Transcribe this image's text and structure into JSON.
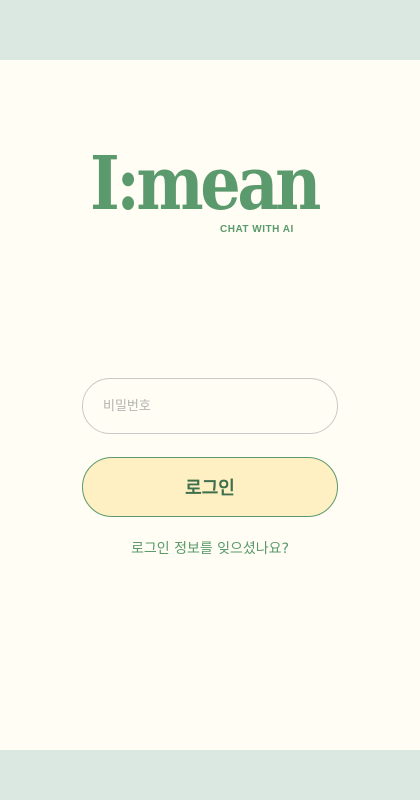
{
  "logo": {
    "wordmark": "I:mean",
    "tagline": "CHAT WITH AI"
  },
  "login_form": {
    "password_placeholder": "비밀번호",
    "password_value": "",
    "login_label": "로그인",
    "forgot_label": "로그인 정보를 잊으셨나요?"
  },
  "colors": {
    "brand_green": "#5a9a6c",
    "button_fill": "#fff0c4",
    "page_background": "#fffdf4",
    "outer_background": "#dbe8e1"
  }
}
